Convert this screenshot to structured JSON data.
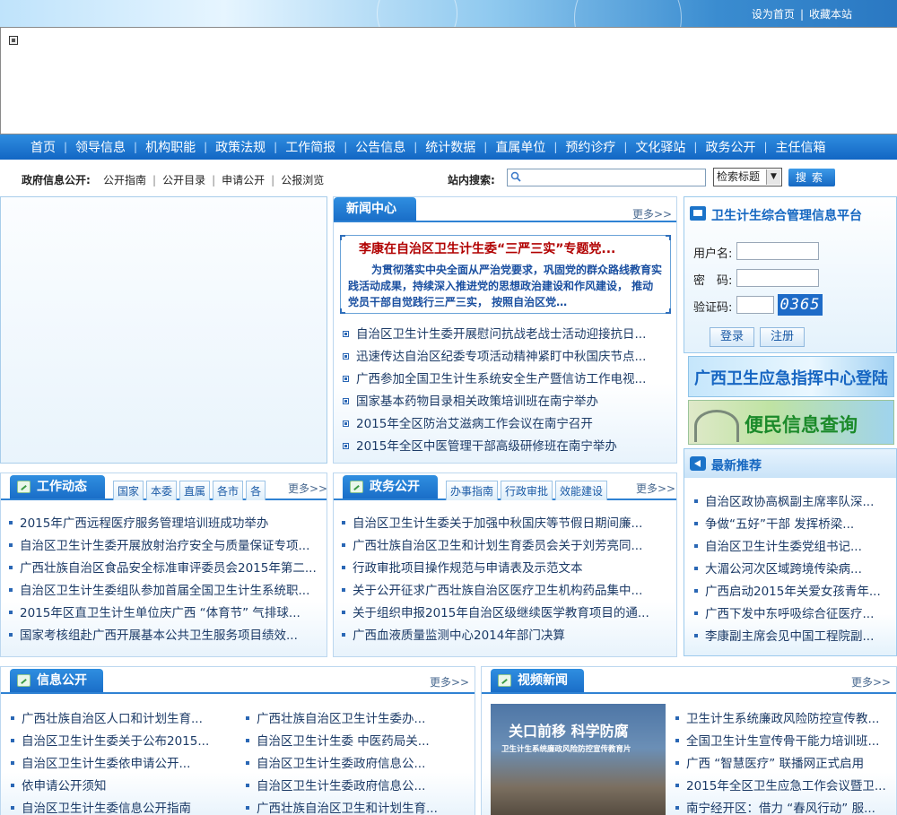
{
  "header": {
    "links": [
      "设为首页",
      "收藏本站"
    ]
  },
  "nav": {
    "items": [
      "首页",
      "领导信息",
      "机构职能",
      "政策法规",
      "工作简报",
      "公告信息",
      "统计数据",
      "直属单位",
      "预约诊疗",
      "文化驿站",
      "政务公开",
      "主任信箱"
    ]
  },
  "search_row": {
    "gov_label": "政府信息公开:",
    "gov_links": [
      "公开指南",
      "公开目录",
      "申请公开",
      "公报浏览"
    ],
    "search_label": "站内搜索:",
    "search_value": "",
    "select_value": "检索标题",
    "button": "搜索"
  },
  "news_center": {
    "title": "新闻中心",
    "more": "更多>>",
    "feature_title": "李康在自治区卫生计生委“三严三实”专题党...",
    "feature_text": "为贯彻落实中央全面从严治党要求，巩固党的群众路线教育实践活动成果，持续深入推进党的思想政治建设和作风建设， 推动党员干部自觉践行三严三实， 按照自治区党…",
    "items": [
      "自治区卫生计生委开展慰问抗战老战士活动迎接抗日...",
      "迅速传达自治区纪委专项活动精神紧盯中秋国庆节点...",
      "广西参加全国卫生计生系统安全生产暨信访工作电视...",
      "国家基本药物目录相关政策培训班在南宁举办",
      "2015年全区防治艾滋病工作会议在南宁召开",
      "2015年全区中医管理干部高级研修班在南宁举办"
    ]
  },
  "login": {
    "title": "卫生计生综合管理信息平台",
    "username_label": "用户名:",
    "password_label": "密　码:",
    "captcha_label": "验证码:",
    "captcha_value": "0365",
    "login_button": "登录",
    "register_button": "注册"
  },
  "banners": {
    "emergency": "广西卫生应急指挥中心登陆",
    "info_query": "便民信息查询"
  },
  "recommend": {
    "title": "最新推荐",
    "items": [
      "自治区政协高枫副主席率队深...",
      "争做“五好”干部 发挥桥梁...",
      "自治区卫生计生委党组书记...",
      "大湄公河次区域跨境传染病...",
      "广西启动2015年关爱女孩青年...",
      "广西下发中东呼吸综合征医疗...",
      "李康副主席会见中国工程院副..."
    ]
  },
  "work": {
    "title": "工作动态",
    "tabs": [
      "国家",
      "本委",
      "直属",
      "各市",
      "各"
    ],
    "more": "更多>>",
    "items": [
      "2015年广西远程医疗服务管理培训班成功举办",
      "自治区卫生计生委开展放射治疗安全与质量保证专项...",
      "广西壮族自治区食品安全标准审评委员会2015年第二...",
      "自治区卫生计生委组队参加首届全国卫生计生系统职...",
      "2015年区直卫生计生单位庆广西 “体育节” 气排球...",
      "国家考核组赴广西开展基本公共卫生服务项目绩效..."
    ]
  },
  "gov_affairs": {
    "title": "政务公开",
    "tabs": [
      "办事指南",
      "行政审批",
      "效能建设"
    ],
    "more": "更多>>",
    "items": [
      "自治区卫生计生委关于加强中秋国庆等节假日期间廉...",
      "广西壮族自治区卫生和计划生育委员会关于刘芳亮同...",
      "行政审批项目操作规范与申请表及示范文本",
      "关于公开征求广西壮族自治区医疗卫生机构药品集中...",
      "关于组织申报2015年自治区级继续医学教育项目的通...",
      "广西血液质量监测中心2014年部门决算"
    ]
  },
  "info_open": {
    "title": "信息公开",
    "more": "更多>>",
    "left_items": [
      "广西壮族自治区人口和计划生育...",
      "自治区卫生计生委关于公布2015...",
      "自治区卫生计生委依申请公开...",
      "依申请公开须知",
      "自治区卫生计生委信息公开指南"
    ],
    "right_items": [
      "广西壮族自治区卫生计生委办...",
      "自治区卫生计生委 中医药局关...",
      "自治区卫生计生委政府信息公...",
      "自治区卫生计生委政府信息公...",
      "广西壮族自治区卫生和计划生育..."
    ]
  },
  "video": {
    "title": "视频新闻",
    "more": "更多>>",
    "image_title": "关口前移 科学防腐",
    "image_subtitle": "卫生计生系统廉政风险防控宣传教育片",
    "items": [
      "卫生计生系统廉政风险防控宣传教...",
      "全国卫生计生宣传骨干能力培训班...",
      "广西 “智慧医疗” 联播网正式启用",
      "2015年全区卫生应急工作会议暨卫...",
      "南宁经开区：借力 “春风行动” 服..."
    ]
  },
  "colors": {
    "nav_blue": "#1a74d2",
    "title_blue": "#1466c0",
    "feature_red": "#b10000"
  }
}
